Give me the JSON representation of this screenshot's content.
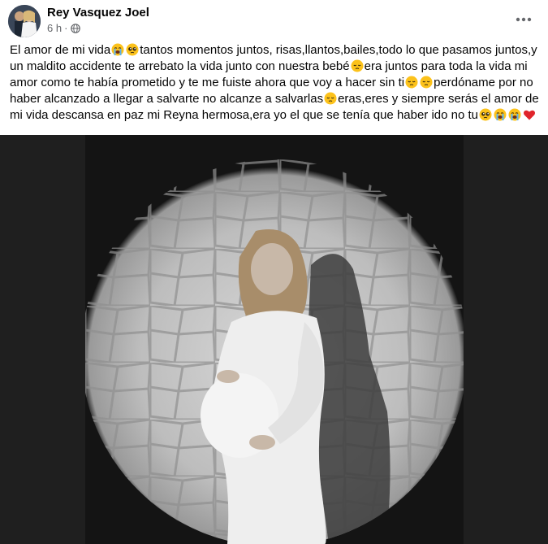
{
  "post": {
    "author": "Rey Vasquez Joel",
    "time": "6 h",
    "separator": "·",
    "privacy_icon": "globe-icon",
    "more_icon": "more-options-icon"
  },
  "text_segments": [
    "El amor de mi vida",
    "tantos momentos juntos, risas,llantos,bailes,todo lo que pasamos juntos,y un maldito accidente te arrebato la vida junto con nuestra bebé",
    "era juntos para toda la vida mi amor como te había prometido y te me fuiste ahora que voy a hacer sin ti",
    "perdóname por no haber alcanzado a llegar a salvarte no alcanze a salvarlas",
    "eras,eres y siempre serás el amor de mi vida descansa en paz mi Reyna hermosa,era yo el que se tenía que haber ido no tu"
  ],
  "emojis": {
    "crying": "loudly-crying-face",
    "pleading": "pleading-face",
    "pensive": "pensive-face",
    "heart": "red-heart"
  },
  "photo": {
    "description_icon": "pregnant-woman-photo"
  }
}
